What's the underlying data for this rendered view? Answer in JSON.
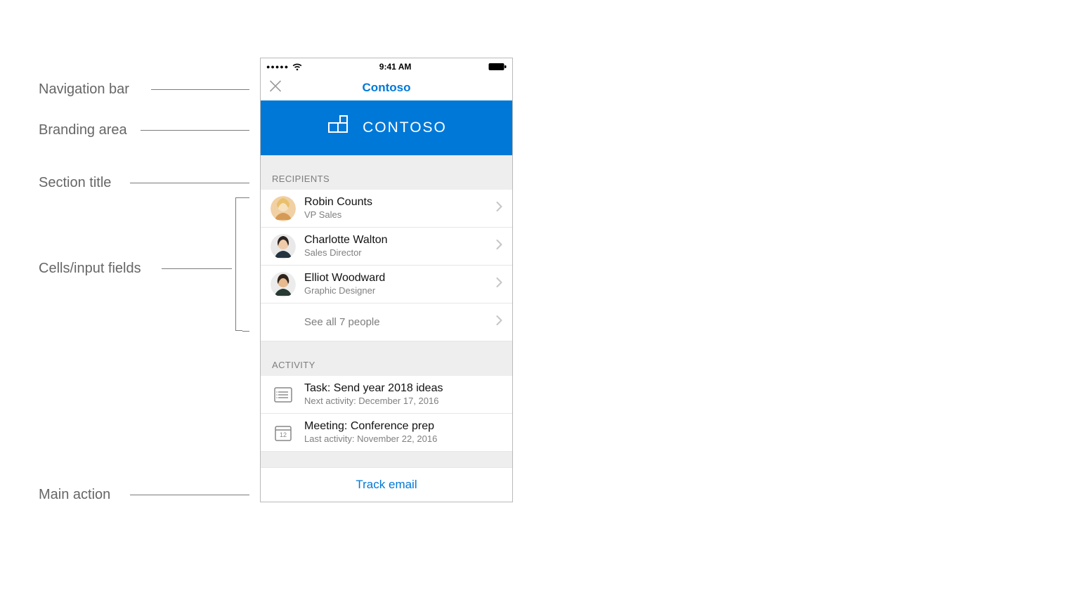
{
  "annotations": {
    "nav": "Navigation bar",
    "branding": "Branding area",
    "sectionTitle": "Section title",
    "cells": "Cells/input fields",
    "mainAction": "Main action"
  },
  "statusBar": {
    "time": "9:41 AM"
  },
  "navBar": {
    "title": "Contoso"
  },
  "branding": {
    "label": "CONTOSO",
    "accentColor": "#0078d7"
  },
  "sections": {
    "recipients": {
      "header": "RECIPIENTS",
      "items": [
        {
          "name": "Robin Counts",
          "role": "VP Sales"
        },
        {
          "name": "Charlotte Walton",
          "role": "Sales Director"
        },
        {
          "name": "Elliot Woodward",
          "role": "Graphic Designer"
        }
      ],
      "seeAll": "See all 7 people"
    },
    "activity": {
      "header": "ACTIVITY",
      "items": [
        {
          "title": "Task: Send year 2018 ideas",
          "sub": "Next activity: December 17, 2016",
          "icon": "list"
        },
        {
          "title": "Meeting: Conference prep",
          "sub": "Last activity: November 22, 2016",
          "icon": "calendar",
          "day": "12"
        }
      ]
    }
  },
  "mainAction": {
    "label": "Track email"
  }
}
